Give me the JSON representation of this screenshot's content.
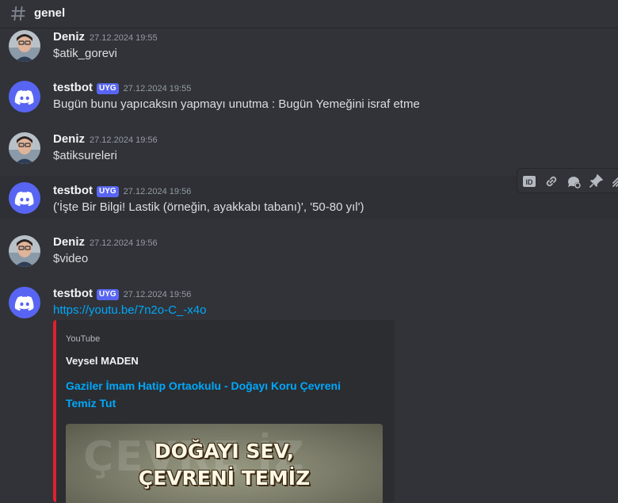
{
  "channel": {
    "name": "genel",
    "icon": "hash-icon"
  },
  "users": {
    "deniz": {
      "name": "Deniz"
    },
    "bot": {
      "name": "testbot",
      "badge": "UYG"
    }
  },
  "messages": [
    {
      "author": "Deniz",
      "time": "27.12.2024 19:55",
      "text": "$atik_gorevi"
    },
    {
      "author": "testbot",
      "badge": "UYG",
      "time": "27.12.2024 19:55",
      "text": "Bugün bunu yapıcaksın yapmayı unutma : Bugün Yemeğini israf etme"
    },
    {
      "author": "Deniz",
      "time": "27.12.2024 19:56",
      "text": "$atiksureleri"
    },
    {
      "author": "testbot",
      "badge": "UYG",
      "time": "27.12.2024 19:56",
      "text": "('İşte Bir Bilgi! Lastik (örneğin, ayakkabı tabanı)', '50-80 yıl')"
    },
    {
      "author": "Deniz",
      "time": "27.12.2024 19:56",
      "text": "$video"
    },
    {
      "author": "testbot",
      "badge": "UYG",
      "time": "27.12.2024 19:56",
      "text": "https://youtu.be/7n2o-C_-x4o"
    }
  ],
  "embed": {
    "provider": "YouTube",
    "author": "Veysel MADEN",
    "title": "Gaziler İmam Hatip Ortaokulu - Doğayı Koru Çevreni Temiz Tut",
    "thumbnail_line1": "DOĞAYI SEV,",
    "thumbnail_line2": "ÇEVRENİ TEMİZ",
    "thumbnail_bg_text": "ÇEVRE  İZ",
    "accent_color": "#e0202f"
  },
  "toolbar": {
    "icons": [
      "id-icon",
      "link-icon",
      "thread-icon",
      "pin-icon",
      "more-icon"
    ]
  },
  "colors": {
    "background": "#313338",
    "link": "#00a8fc",
    "bot_badge": "#5865f2",
    "discord_avatar": "#5865f2"
  }
}
